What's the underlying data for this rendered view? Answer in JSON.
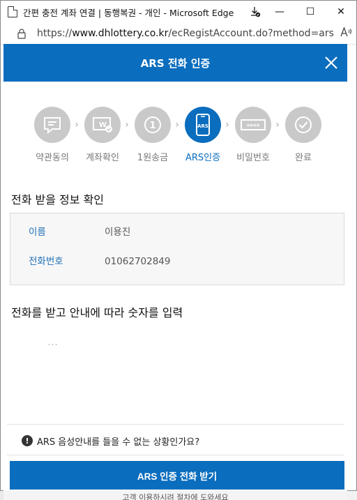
{
  "window": {
    "title": "간편 충전 계좌 연결 | 동행복권 - 개인 - Microsoft Edge",
    "controls": {
      "minimize": "—",
      "maximize": "☐",
      "close": "✕"
    }
  },
  "address": {
    "scheme": "https://",
    "host": "www.dhlottery.co.kr",
    "path": "/ecRegistAccount.do?method=ars",
    "reader_label": "Á́"
  },
  "modal": {
    "title": "ARS 전화 인증",
    "steps": [
      {
        "label": "약관동의",
        "icon": "terms-icon"
      },
      {
        "label": "계좌확인",
        "icon": "account-check-icon"
      },
      {
        "label": "1원송금",
        "icon": "one-won-icon",
        "icon_text": "1"
      },
      {
        "label": "ARS인증",
        "icon": "ars-phone-icon",
        "icon_text": "ARS"
      },
      {
        "label": "비밀번호",
        "icon": "password-icon",
        "icon_text": "****"
      },
      {
        "label": "완료",
        "icon": "complete-icon"
      }
    ],
    "active_step": 3,
    "info_section_title": "전화 받을 정보 확인",
    "info": {
      "name_label": "이름",
      "name_value": "이용진",
      "phone_label": "전화번호",
      "phone_value": "01062702849"
    },
    "input_section_title": "전화를 받고 안내에 따라 숫자를 입력",
    "dots_text": "·    ·   ·",
    "help_text": "ARS 음성안내를 들을 수 없는 상황인가요?",
    "cta_label": "ARS 인증 전화 받기"
  },
  "background": {
    "bottom_text": "고객 이용하시려 절차에 도와세요"
  },
  "colors": {
    "brand": "#0a6dbe",
    "step_inactive": "#c9c9c9",
    "label_blue": "#1f6fb6"
  }
}
